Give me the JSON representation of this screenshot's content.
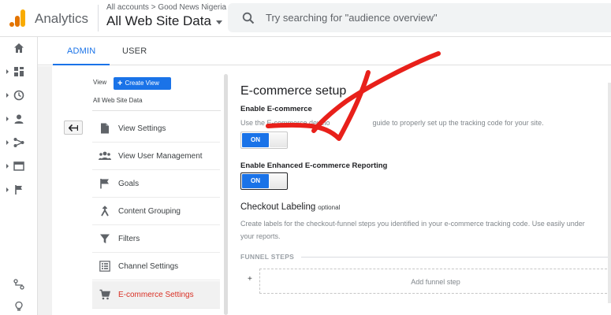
{
  "app": {
    "name": "Analytics"
  },
  "header": {
    "breadcrumb": "All accounts > Good News Nigeria",
    "property": "All Web Site Data",
    "search_placeholder": "Try searching for \"audience overview\""
  },
  "tabs": [
    {
      "label": "ADMIN",
      "active": true
    },
    {
      "label": "USER",
      "active": false
    }
  ],
  "view_column": {
    "view_label": "View",
    "create_view_label": "Create View",
    "view_name": "All Web Site Data",
    "menu": [
      {
        "label": "View Settings",
        "icon": "document-icon",
        "active": false
      },
      {
        "label": "View User Management",
        "icon": "people-icon",
        "active": false
      },
      {
        "label": "Goals",
        "icon": "flag-icon",
        "active": false
      },
      {
        "label": "Content Grouping",
        "icon": "merge-icon",
        "active": false
      },
      {
        "label": "Filters",
        "icon": "filter-icon",
        "active": false
      },
      {
        "label": "Channel Settings",
        "icon": "list-icon",
        "active": false
      },
      {
        "label": "E-commerce Settings",
        "icon": "cart-icon",
        "active": true
      }
    ]
  },
  "main": {
    "title": "E-commerce setup",
    "enable_ecommerce": {
      "label": "Enable E-commerce",
      "description": "Use the E-commerce develo",
      "description_end": "guide to properly set up the tracking code for your site.",
      "toggle": "ON"
    },
    "enhanced": {
      "label": "Enable Enhanced E-commerce Reporting",
      "toggle": "ON"
    },
    "checkout": {
      "title": "Checkout Labeling",
      "optional": "optional",
      "desc_line1": "Create labels for the checkout-funnel steps you identified in your e-commerce tracking code. Use easily under",
      "desc_line2": "your reports."
    },
    "funnel_steps_title": "FUNNEL STEPS",
    "plus": "+",
    "add_funnel_step": "Add funnel step"
  },
  "colors": {
    "accent": "#1a73e8",
    "active_text": "#d93025",
    "annotation": "#e8201a"
  }
}
